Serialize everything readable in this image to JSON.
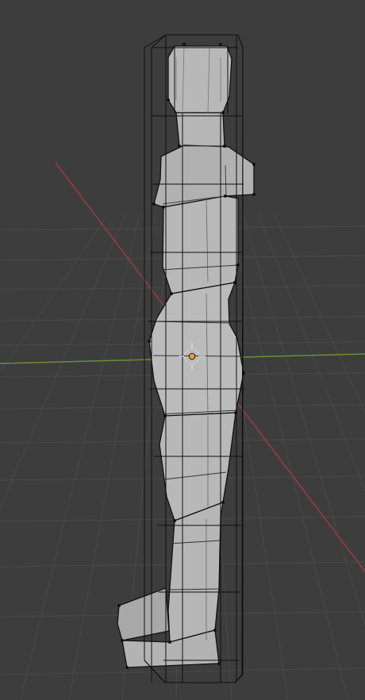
{
  "viewport": {
    "background_color": "#3d3d3d",
    "grid_color": "#4a4a4a",
    "x_axis_color": "#9d3a45",
    "y_axis_color": "#6b8f3a",
    "mesh_fill_color": "#b9b9b9",
    "mesh_shade_color": "#9f9f9f",
    "wire_color": "#111111",
    "cage_color": "#0f0f0f",
    "origin_color": "#f09a2b"
  },
  "scene": {
    "object_name": "",
    "view_type": "3d-viewport"
  },
  "icons": {
    "origin": "origin-icon",
    "cursor": "3d-cursor-icon"
  }
}
